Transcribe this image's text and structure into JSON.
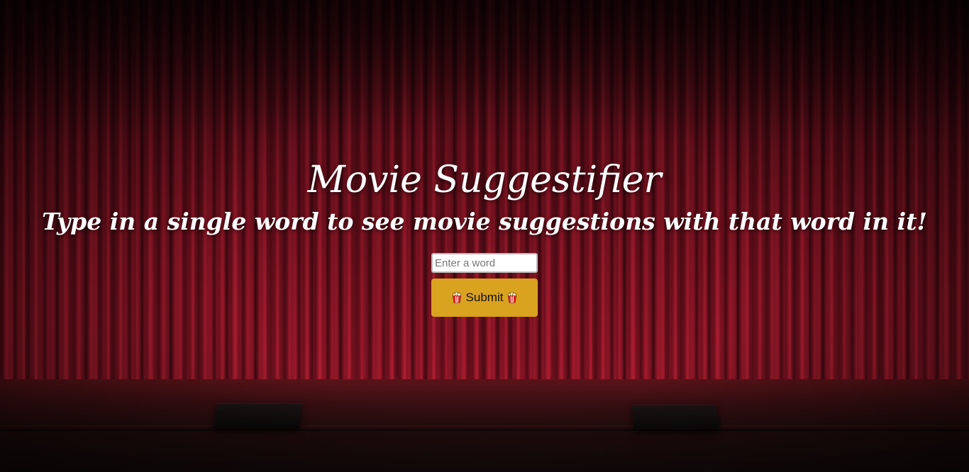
{
  "header": {
    "title": "Movie Suggestifier",
    "subtitle": "Type in a single word to see movie suggestions with that word in it!"
  },
  "form": {
    "input_placeholder": "Enter a word",
    "input_value": "",
    "submit_label": "Submit",
    "submit_icon": "popcorn-icon"
  },
  "colors": {
    "curtain": "#a0162a",
    "button": "#d9a21f",
    "text": "#ffffff"
  }
}
